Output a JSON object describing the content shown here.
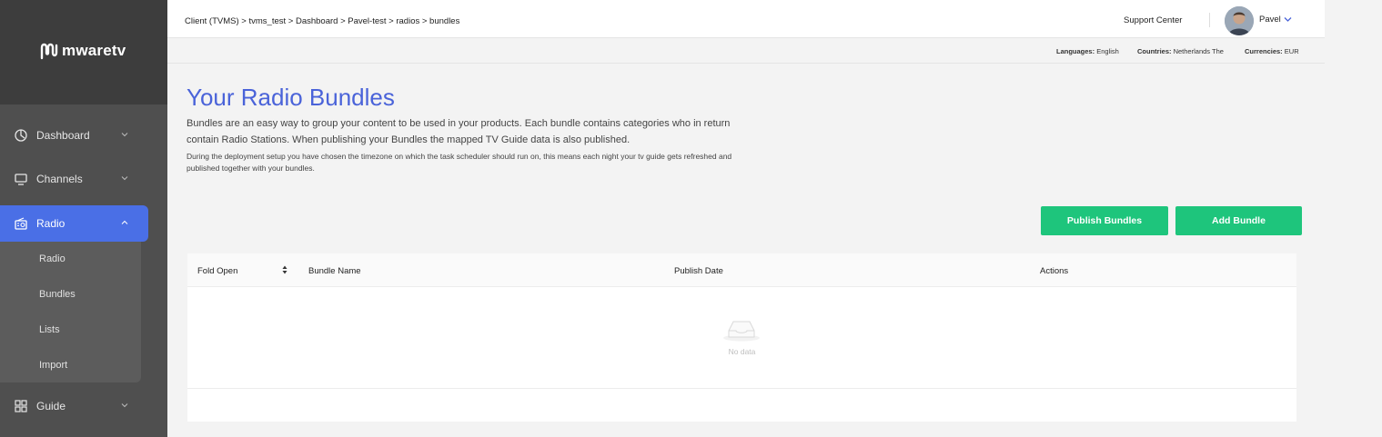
{
  "brand": {
    "logo_text": "mwaretv"
  },
  "sidebar": {
    "items": [
      {
        "label": "Dashboard",
        "icon": "dashboard-icon"
      },
      {
        "label": "Channels",
        "icon": "monitor-icon"
      },
      {
        "label": "Radio",
        "icon": "radio-icon"
      },
      {
        "label": "Guide",
        "icon": "grid-icon"
      }
    ],
    "submenu": [
      {
        "label": "Radio"
      },
      {
        "label": "Bundles"
      },
      {
        "label": "Lists"
      },
      {
        "label": "Import"
      }
    ],
    "active_color": "#4a6fe6"
  },
  "header": {
    "breadcrumb": [
      "Client (TVMS)",
      " > tvms_test",
      " > Dashboard",
      " > Pavel-test",
      " > radios",
      " > bundles"
    ],
    "support_label": "Support Center",
    "user_name": "Pavel"
  },
  "meta": {
    "languages_label": "Languages:",
    "languages_value": "English",
    "countries_label": "Countries:",
    "countries_value": "Netherlands The",
    "currencies_label": "Currencies:",
    "currencies_value": "EUR"
  },
  "main": {
    "title": "Your Radio Bundles",
    "description": "Bundles are an easy way to group your content to be used in your products. Each bundle contains categories who in return contain Radio Stations. When publishing your Bundles the mapped TV Guide data is also published.",
    "description_small": "During the deployment setup you have chosen the timezone on which the task scheduler should run on, this means each night your tv guide gets refreshed and published together with your bundles.",
    "publish_button": "Publish Bundles",
    "add_button": "Add Bundle",
    "accent_color": "#1ec57c",
    "title_color": "#4a63d9"
  },
  "table": {
    "columns": [
      "Fold Open",
      "Bundle Name",
      "Publish Date",
      "Actions"
    ],
    "empty_text": "No data"
  }
}
